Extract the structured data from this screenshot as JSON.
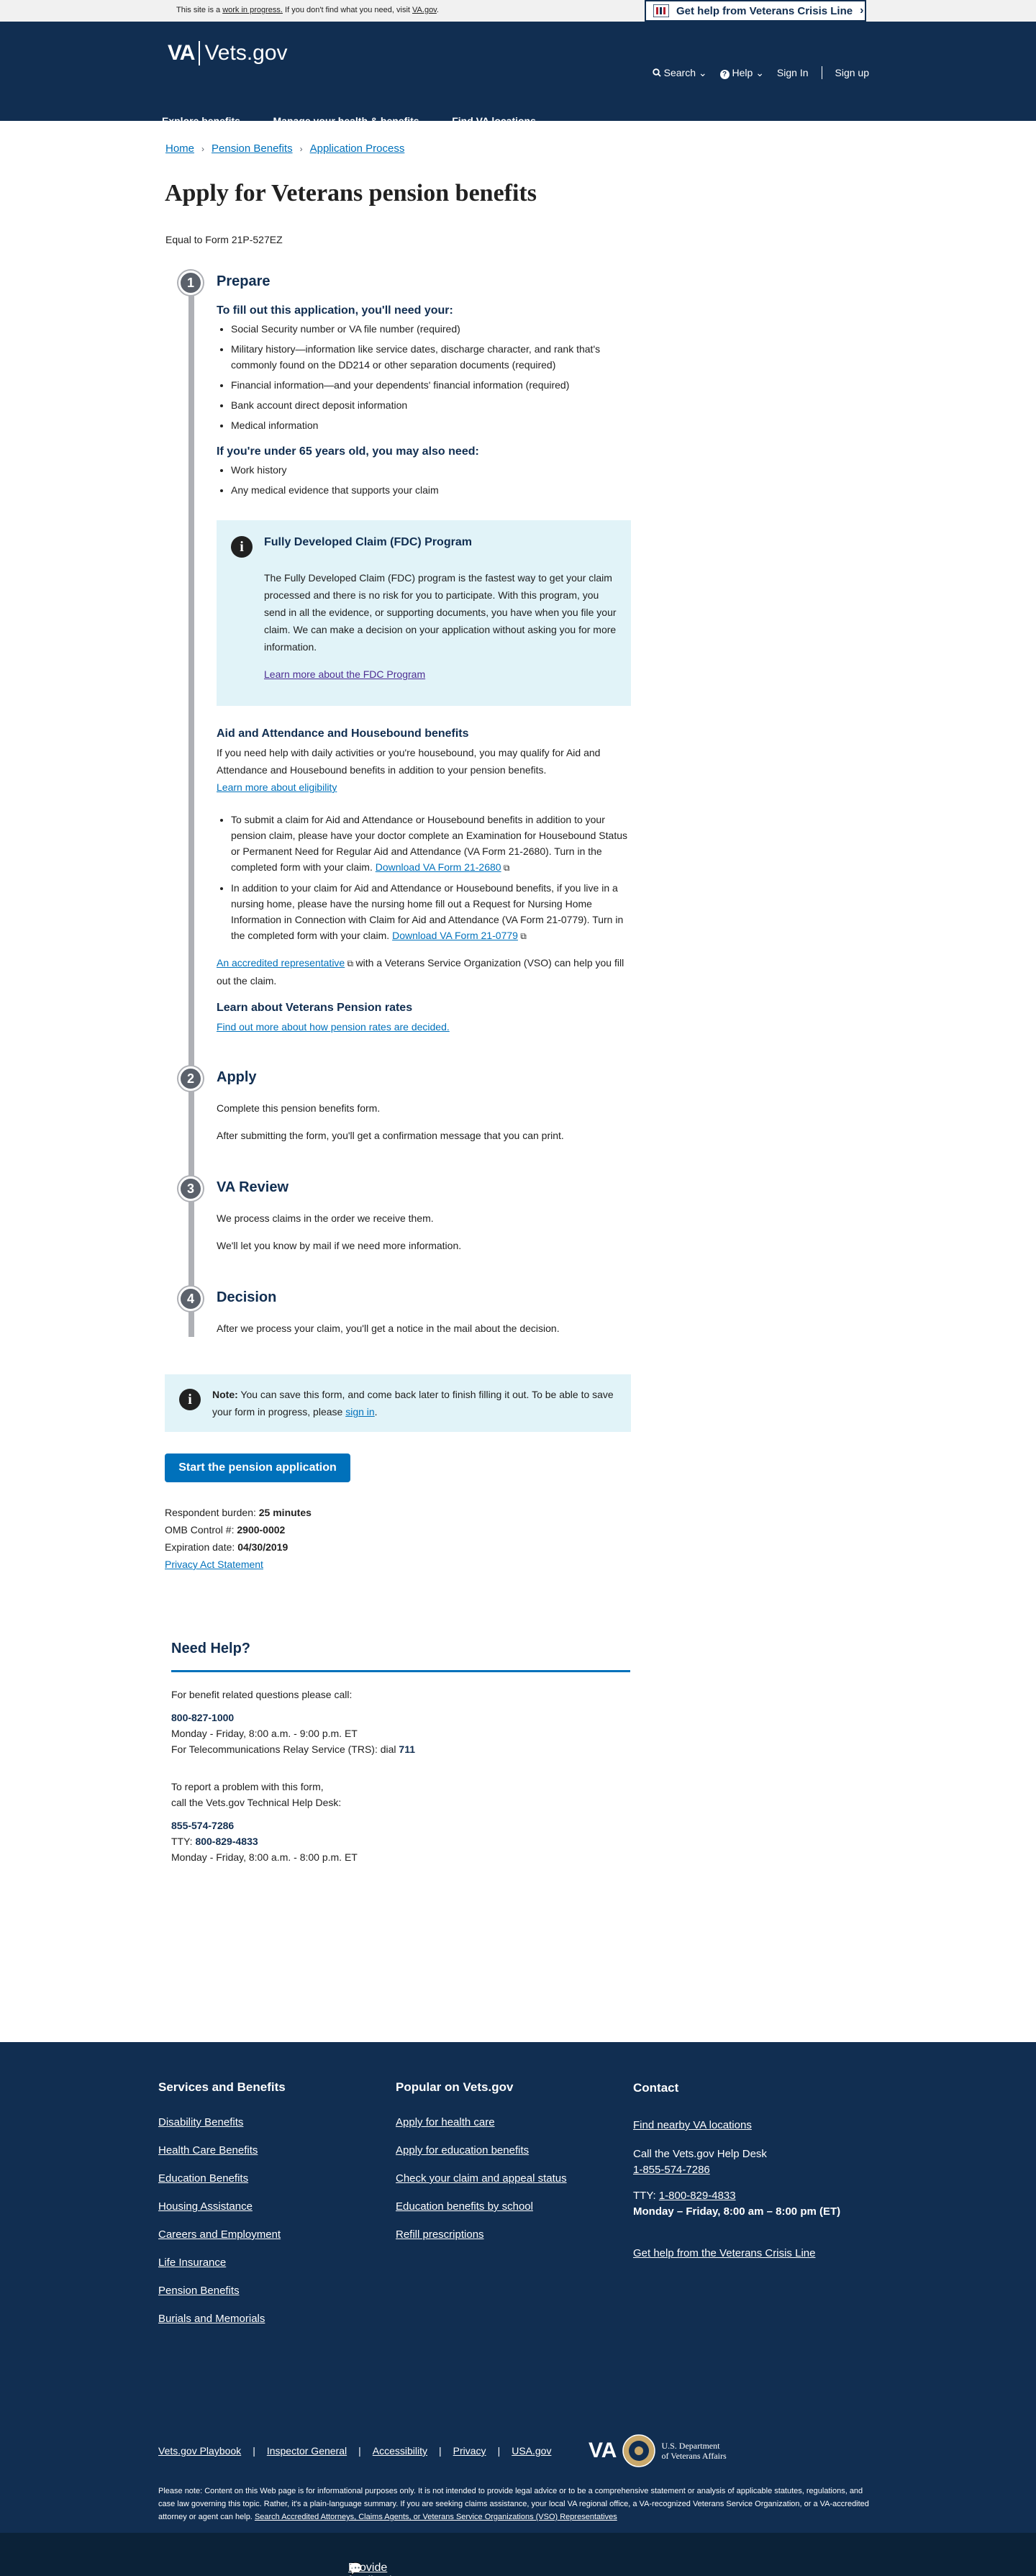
{
  "banner": {
    "beta_prefix": "This site is a",
    "beta_link": "work in progress.",
    "beta_mid": "If you don't find what you need, visit",
    "beta_va_link": "VA.gov",
    "beta_end": ".",
    "crisis_label": "Get help from Veterans Crisis Line"
  },
  "header": {
    "logo_va": "VA",
    "logo_vets": "Vets.gov",
    "search": "Search",
    "help": "Help",
    "sign_in": "Sign In",
    "sign_up": "Sign up",
    "nav": [
      "Explore benefits",
      "Manage your health & benefits",
      "Find VA locations"
    ]
  },
  "breadcrumb": [
    "Home",
    "Pension Benefits",
    "Application Process"
  ],
  "page": {
    "title": "Apply for Veterans pension benefits",
    "form_number": "Equal to Form 21P-527EZ"
  },
  "steps": {
    "prepare": {
      "num": "1",
      "title": "Prepare",
      "need_heading": "To fill out this application, you'll need your:",
      "need_items": [
        "Social Security number or VA file number (required)",
        "Military history—information like service dates, discharge character, and rank that's commonly found on the DD214 or other separation documents (required)",
        "Financial information—and your dependents' financial information (required)",
        "Bank account direct deposit information",
        "Medical information"
      ],
      "under65_heading": "If you're under 65 years old, you may also need:",
      "under65_items": [
        "Work history",
        "Any medical evidence that supports your claim"
      ],
      "fdc_title": "Fully Developed Claim (FDC) Program",
      "fdc_body": "The Fully Developed Claim (FDC) program is the fastest way to get your claim processed and there is no risk for you to participate. With this program, you send in all the evidence, or supporting documents, you have when you file your claim. We can make a decision on your application without asking you for more information.",
      "fdc_link": "Learn more about the FDC Program",
      "aa_heading": "Aid and Attendance and Housebound benefits",
      "aa_body": "If you need help with daily activities or you're housebound, you may qualify for Aid and Attendance and Housebound benefits in addition to your pension benefits.",
      "aa_link": "Learn more about eligibility",
      "aa_item1": "To submit a claim for Aid and Attendance or Housebound benefits in addition to your pension claim, please have your doctor complete an Examination for Housebound Status or Permanent Need for Regular Aid and Attendance (VA Form 21-2680). Turn in the completed form with your claim.",
      "aa_item1_link": "Download VA Form 21-2680",
      "aa_item2": "In addition to your claim for Aid and Attendance or Housebound benefits, if you live in a nursing home, please have the nursing home fill out a Request for Nursing Home Information in Connection with Claim for Aid and Attendance (VA Form 21-0779). Turn in the completed form with your claim.",
      "aa_item2_link": "Download VA Form 21-0779",
      "vso_link": "An accredited representative",
      "vso_text": "with a Veterans Service Organization (VSO) can help you fill out the claim.",
      "rates_heading": "Learn about Veterans Pension rates",
      "rates_link": "Find out more about how pension rates are decided."
    },
    "apply": {
      "num": "2",
      "title": "Apply",
      "p1": "Complete this pension benefits form.",
      "p2": "After submitting the form, you'll get a confirmation message that you can print."
    },
    "review": {
      "num": "3",
      "title": "VA Review",
      "p1": "We process claims in the order we receive them.",
      "p2": "We'll let you know by mail if we need more information."
    },
    "decision": {
      "num": "4",
      "title": "Decision",
      "p1": "After we process your claim, you'll get a notice in the mail about the decision."
    }
  },
  "note": {
    "label": "Note:",
    "text": "You can save this form, and come back later to finish filling it out. To be able to save your form in progress, please",
    "link": "sign in",
    "end": "."
  },
  "start_button": "Start the pension application",
  "omb": {
    "burden_label": "Respondent burden:",
    "burden_value": "25 minutes",
    "control_label": "OMB Control #:",
    "control_value": "2900-0002",
    "exp_label": "Expiration date:",
    "exp_value": "04/30/2019",
    "privacy": "Privacy Act Statement"
  },
  "help": {
    "title": "Need Help?",
    "intro": "For benefit related questions please call:",
    "phone1": "800-827-1000",
    "hours1": "Monday - Friday, 8:00 a.m. - 9:00 p.m. ET",
    "trs": "For Telecommunications Relay Service (TRS): dial",
    "trs_num": "711",
    "report1": "To report a problem with this form,",
    "report2": "call the Vets.gov Technical Help Desk:",
    "phone2": "855-574-7286",
    "tty_label": "TTY:",
    "tty": "800-829-4833",
    "hours2": "Monday - Friday, 8:00 a.m. - 8:00 p.m. ET"
  },
  "footer": {
    "col1_title": "Services and Benefits",
    "col1": [
      "Disability Benefits",
      "Health Care Benefits",
      "Education Benefits",
      "Housing Assistance",
      "Careers and Employment",
      "Life Insurance",
      "Pension Benefits",
      "Burials and Memorials"
    ],
    "col2_title": "Popular on Vets.gov",
    "col2": [
      "Apply for health care",
      "Apply for education benefits",
      "Check your claim and appeal status",
      "Education benefits by school",
      "Refill prescriptions"
    ],
    "col3_title": "Contact",
    "find_va": "Find nearby VA locations",
    "call_desk": "Call the Vets.gov Help Desk",
    "desk_phone": "1-855-574-7286",
    "tty_label": "TTY:",
    "tty": "1-800-829-4833",
    "hours": "Monday – Friday, 8:00 am – 8:00 pm (ET)",
    "crisis": "Get help from the Veterans Crisis Line",
    "bottom_links": [
      "Vets.gov Playbook",
      "Inspector General",
      "Accessibility",
      "Privacy",
      "USA.gov"
    ],
    "va_logo": "VA",
    "dept1": "U.S. Department",
    "dept2": "of Veterans Affairs",
    "disclaimer": "Please note: Content on this Web page is for informational purposes only. It is not intended to provide legal advice or to be a comprehensive statement or analysis of applicable statutes, regulations, and case law governing this topic. Rather, it's a plain-language summary. If you are seeking claims assistance, your local VA regional office, a VA-recognized Veterans Service Organization, or a VA-accredited attorney or agent can help.",
    "disclaimer_link": "Search Accredited Attorneys, Claims Agents, or Veterans Service Organizations (VSO) Representatives",
    "feedback": "Provide feedback on vets.gov"
  }
}
